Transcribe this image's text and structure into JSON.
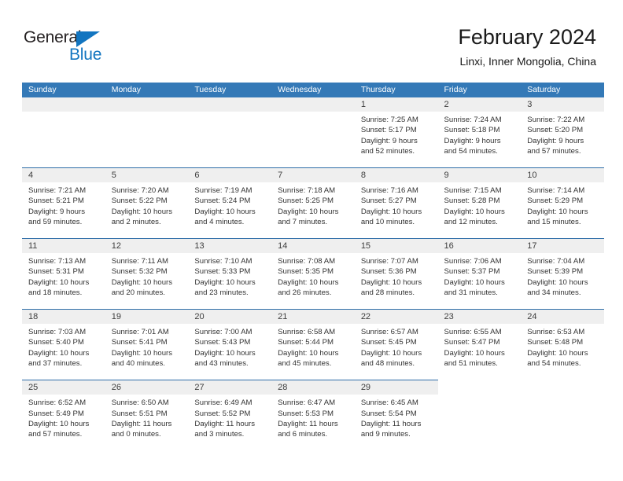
{
  "brand": {
    "name_part1": "General",
    "name_part2": "Blue",
    "triangle_color": "#1275c0"
  },
  "header": {
    "title": "February 2024",
    "subtitle": "Linxi, Inner Mongolia, China"
  },
  "colors": {
    "header_bar": "#3479b7",
    "row_separator": "#2f6ea8",
    "daynum_band": "#efefef",
    "text": "#333333"
  },
  "weekdays": [
    "Sunday",
    "Monday",
    "Tuesday",
    "Wednesday",
    "Thursday",
    "Friday",
    "Saturday"
  ],
  "labels": {
    "sunrise_prefix": "Sunrise:",
    "sunset_prefix": "Sunset:",
    "daylight_prefix": "Daylight:"
  },
  "weeks": [
    {
      "days": [
        {
          "date": "",
          "blank": true
        },
        {
          "date": "",
          "blank": true
        },
        {
          "date": "",
          "blank": true
        },
        {
          "date": "",
          "blank": true
        },
        {
          "date": "1",
          "sunrise": "Sunrise: 7:25 AM",
          "sunset": "Sunset: 5:17 PM",
          "daylight_line1": "Daylight: 9 hours",
          "daylight_line2": "and 52 minutes."
        },
        {
          "date": "2",
          "sunrise": "Sunrise: 7:24 AM",
          "sunset": "Sunset: 5:18 PM",
          "daylight_line1": "Daylight: 9 hours",
          "daylight_line2": "and 54 minutes."
        },
        {
          "date": "3",
          "sunrise": "Sunrise: 7:22 AM",
          "sunset": "Sunset: 5:20 PM",
          "daylight_line1": "Daylight: 9 hours",
          "daylight_line2": "and 57 minutes."
        }
      ]
    },
    {
      "days": [
        {
          "date": "4",
          "sunrise": "Sunrise: 7:21 AM",
          "sunset": "Sunset: 5:21 PM",
          "daylight_line1": "Daylight: 9 hours",
          "daylight_line2": "and 59 minutes."
        },
        {
          "date": "5",
          "sunrise": "Sunrise: 7:20 AM",
          "sunset": "Sunset: 5:22 PM",
          "daylight_line1": "Daylight: 10 hours",
          "daylight_line2": "and 2 minutes."
        },
        {
          "date": "6",
          "sunrise": "Sunrise: 7:19 AM",
          "sunset": "Sunset: 5:24 PM",
          "daylight_line1": "Daylight: 10 hours",
          "daylight_line2": "and 4 minutes."
        },
        {
          "date": "7",
          "sunrise": "Sunrise: 7:18 AM",
          "sunset": "Sunset: 5:25 PM",
          "daylight_line1": "Daylight: 10 hours",
          "daylight_line2": "and 7 minutes."
        },
        {
          "date": "8",
          "sunrise": "Sunrise: 7:16 AM",
          "sunset": "Sunset: 5:27 PM",
          "daylight_line1": "Daylight: 10 hours",
          "daylight_line2": "and 10 minutes."
        },
        {
          "date": "9",
          "sunrise": "Sunrise: 7:15 AM",
          "sunset": "Sunset: 5:28 PM",
          "daylight_line1": "Daylight: 10 hours",
          "daylight_line2": "and 12 minutes."
        },
        {
          "date": "10",
          "sunrise": "Sunrise: 7:14 AM",
          "sunset": "Sunset: 5:29 PM",
          "daylight_line1": "Daylight: 10 hours",
          "daylight_line2": "and 15 minutes."
        }
      ]
    },
    {
      "days": [
        {
          "date": "11",
          "sunrise": "Sunrise: 7:13 AM",
          "sunset": "Sunset: 5:31 PM",
          "daylight_line1": "Daylight: 10 hours",
          "daylight_line2": "and 18 minutes."
        },
        {
          "date": "12",
          "sunrise": "Sunrise: 7:11 AM",
          "sunset": "Sunset: 5:32 PM",
          "daylight_line1": "Daylight: 10 hours",
          "daylight_line2": "and 20 minutes."
        },
        {
          "date": "13",
          "sunrise": "Sunrise: 7:10 AM",
          "sunset": "Sunset: 5:33 PM",
          "daylight_line1": "Daylight: 10 hours",
          "daylight_line2": "and 23 minutes."
        },
        {
          "date": "14",
          "sunrise": "Sunrise: 7:08 AM",
          "sunset": "Sunset: 5:35 PM",
          "daylight_line1": "Daylight: 10 hours",
          "daylight_line2": "and 26 minutes."
        },
        {
          "date": "15",
          "sunrise": "Sunrise: 7:07 AM",
          "sunset": "Sunset: 5:36 PM",
          "daylight_line1": "Daylight: 10 hours",
          "daylight_line2": "and 28 minutes."
        },
        {
          "date": "16",
          "sunrise": "Sunrise: 7:06 AM",
          "sunset": "Sunset: 5:37 PM",
          "daylight_line1": "Daylight: 10 hours",
          "daylight_line2": "and 31 minutes."
        },
        {
          "date": "17",
          "sunrise": "Sunrise: 7:04 AM",
          "sunset": "Sunset: 5:39 PM",
          "daylight_line1": "Daylight: 10 hours",
          "daylight_line2": "and 34 minutes."
        }
      ]
    },
    {
      "days": [
        {
          "date": "18",
          "sunrise": "Sunrise: 7:03 AM",
          "sunset": "Sunset: 5:40 PM",
          "daylight_line1": "Daylight: 10 hours",
          "daylight_line2": "and 37 minutes."
        },
        {
          "date": "19",
          "sunrise": "Sunrise: 7:01 AM",
          "sunset": "Sunset: 5:41 PM",
          "daylight_line1": "Daylight: 10 hours",
          "daylight_line2": "and 40 minutes."
        },
        {
          "date": "20",
          "sunrise": "Sunrise: 7:00 AM",
          "sunset": "Sunset: 5:43 PM",
          "daylight_line1": "Daylight: 10 hours",
          "daylight_line2": "and 43 minutes."
        },
        {
          "date": "21",
          "sunrise": "Sunrise: 6:58 AM",
          "sunset": "Sunset: 5:44 PM",
          "daylight_line1": "Daylight: 10 hours",
          "daylight_line2": "and 45 minutes."
        },
        {
          "date": "22",
          "sunrise": "Sunrise: 6:57 AM",
          "sunset": "Sunset: 5:45 PM",
          "daylight_line1": "Daylight: 10 hours",
          "daylight_line2": "and 48 minutes."
        },
        {
          "date": "23",
          "sunrise": "Sunrise: 6:55 AM",
          "sunset": "Sunset: 5:47 PM",
          "daylight_line1": "Daylight: 10 hours",
          "daylight_line2": "and 51 minutes."
        },
        {
          "date": "24",
          "sunrise": "Sunrise: 6:53 AM",
          "sunset": "Sunset: 5:48 PM",
          "daylight_line1": "Daylight: 10 hours",
          "daylight_line2": "and 54 minutes."
        }
      ]
    },
    {
      "days": [
        {
          "date": "25",
          "sunrise": "Sunrise: 6:52 AM",
          "sunset": "Sunset: 5:49 PM",
          "daylight_line1": "Daylight: 10 hours",
          "daylight_line2": "and 57 minutes."
        },
        {
          "date": "26",
          "sunrise": "Sunrise: 6:50 AM",
          "sunset": "Sunset: 5:51 PM",
          "daylight_line1": "Daylight: 11 hours",
          "daylight_line2": "and 0 minutes."
        },
        {
          "date": "27",
          "sunrise": "Sunrise: 6:49 AM",
          "sunset": "Sunset: 5:52 PM",
          "daylight_line1": "Daylight: 11 hours",
          "daylight_line2": "and 3 minutes."
        },
        {
          "date": "28",
          "sunrise": "Sunrise: 6:47 AM",
          "sunset": "Sunset: 5:53 PM",
          "daylight_line1": "Daylight: 11 hours",
          "daylight_line2": "and 6 minutes."
        },
        {
          "date": "29",
          "sunrise": "Sunrise: 6:45 AM",
          "sunset": "Sunset: 5:54 PM",
          "daylight_line1": "Daylight: 11 hours",
          "daylight_line2": "and 9 minutes."
        },
        {
          "date": "",
          "blank": true,
          "tail": true
        },
        {
          "date": "",
          "blank": true,
          "tail": true
        }
      ]
    }
  ]
}
